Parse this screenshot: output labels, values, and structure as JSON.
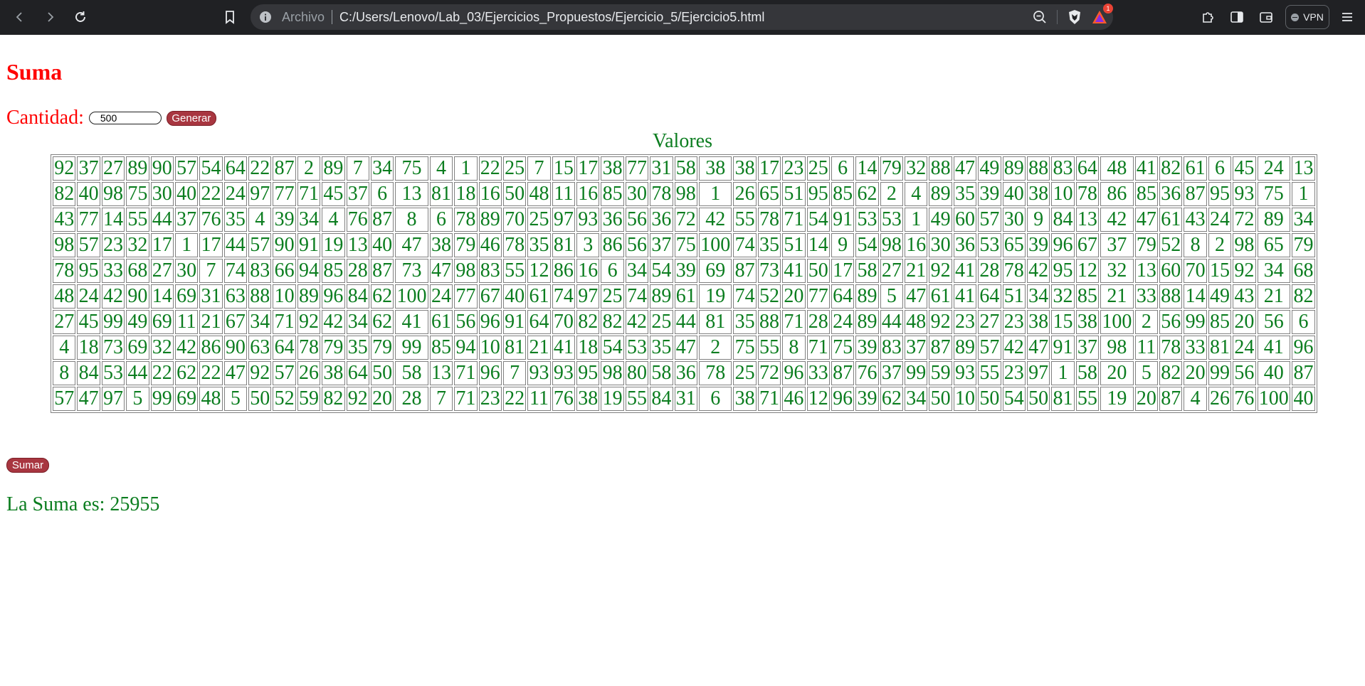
{
  "browser": {
    "url_scheme_label": "Archivo",
    "url": "C:/Users/Lenovo/Lab_03/Ejercicios_Propuestos/Ejercicio_5/Ejercicio5.html",
    "notification_count": "1",
    "vpn_label": "VPN",
    "icons": [
      "back-icon",
      "forward-icon",
      "reload-icon",
      "bookmark-icon",
      "info-icon",
      "zoom-out-icon",
      "brave-shield-icon",
      "brave-rewards-icon",
      "extensions-icon",
      "sidebar-icon",
      "wallet-icon",
      "menu-icon"
    ]
  },
  "page": {
    "title": "Suma",
    "quantity_label": "Cantidad:",
    "quantity_value": "500",
    "generate_label": "Generar",
    "table_caption": "Valores",
    "sum_label": "Sumar",
    "result_text": "La Suma es: 25955"
  },
  "colors": {
    "heading": "#ff0000",
    "values": "#0b7d1f",
    "button": "#a83640"
  },
  "table": {
    "rows": [
      [
        92,
        37,
        27,
        89,
        90,
        57,
        54,
        64,
        22,
        87,
        2,
        89,
        7,
        34,
        75,
        4,
        1,
        22,
        25,
        7,
        15,
        17,
        38,
        77,
        31,
        58,
        38,
        38,
        17,
        23,
        25,
        6,
        14,
        79,
        32,
        88,
        47,
        49,
        89,
        88,
        83,
        64,
        48,
        41,
        82,
        61,
        6,
        45,
        24,
        13
      ],
      [
        82,
        40,
        98,
        75,
        30,
        40,
        22,
        24,
        97,
        77,
        71,
        45,
        37,
        6,
        13,
        81,
        18,
        16,
        50,
        48,
        11,
        16,
        85,
        30,
        78,
        98,
        1,
        26,
        65,
        51,
        95,
        85,
        62,
        2,
        4,
        89,
        35,
        39,
        40,
        38,
        10,
        78,
        86,
        85,
        36,
        87,
        95,
        93,
        75,
        1
      ],
      [
        43,
        77,
        14,
        55,
        44,
        37,
        76,
        35,
        4,
        39,
        34,
        4,
        76,
        87,
        8,
        6,
        78,
        89,
        70,
        25,
        97,
        93,
        36,
        56,
        36,
        72,
        42,
        55,
        78,
        71,
        54,
        91,
        53,
        53,
        1,
        49,
        60,
        57,
        30,
        9,
        84,
        13,
        42,
        47,
        61,
        43,
        24,
        72,
        89,
        34
      ],
      [
        98,
        57,
        23,
        32,
        17,
        1,
        17,
        44,
        57,
        90,
        91,
        19,
        13,
        40,
        47,
        38,
        79,
        46,
        78,
        35,
        81,
        3,
        86,
        56,
        37,
        75,
        100,
        74,
        35,
        51,
        14,
        9,
        54,
        98,
        16,
        30,
        36,
        53,
        65,
        39,
        96,
        67,
        37,
        79,
        52,
        8,
        2,
        98,
        65,
        79
      ],
      [
        78,
        95,
        33,
        68,
        27,
        30,
        7,
        74,
        83,
        66,
        94,
        85,
        28,
        87,
        73,
        47,
        98,
        83,
        55,
        12,
        86,
        16,
        6,
        34,
        54,
        39,
        69,
        87,
        73,
        41,
        50,
        17,
        58,
        27,
        21,
        92,
        41,
        28,
        78,
        42,
        95,
        12,
        32,
        13,
        60,
        70,
        15,
        92,
        34,
        68
      ],
      [
        48,
        24,
        42,
        90,
        14,
        69,
        31,
        63,
        88,
        10,
        89,
        96,
        84,
        62,
        100,
        24,
        77,
        67,
        40,
        61,
        74,
        97,
        25,
        74,
        89,
        61,
        19,
        74,
        52,
        20,
        77,
        64,
        89,
        5,
        47,
        61,
        41,
        64,
        51,
        34,
        32,
        85,
        21,
        33,
        88,
        14,
        49,
        43,
        21,
        82
      ],
      [
        27,
        45,
        99,
        49,
        69,
        11,
        21,
        67,
        34,
        71,
        92,
        42,
        34,
        62,
        41,
        61,
        56,
        96,
        91,
        64,
        70,
        82,
        82,
        42,
        25,
        44,
        81,
        35,
        88,
        71,
        28,
        24,
        89,
        44,
        48,
        92,
        23,
        27,
        23,
        38,
        15,
        38,
        100,
        2,
        56,
        99,
        85,
        20,
        56,
        6
      ],
      [
        4,
        18,
        73,
        69,
        32,
        42,
        86,
        90,
        63,
        64,
        78,
        79,
        35,
        79,
        99,
        85,
        94,
        10,
        81,
        21,
        41,
        18,
        54,
        53,
        35,
        47,
        2,
        75,
        55,
        8,
        71,
        75,
        39,
        83,
        37,
        87,
        89,
        57,
        42,
        47,
        91,
        37,
        98,
        11,
        78,
        33,
        81,
        24,
        41,
        96
      ],
      [
        8,
        84,
        53,
        44,
        22,
        62,
        22,
        47,
        92,
        57,
        26,
        38,
        64,
        50,
        58,
        13,
        71,
        96,
        7,
        93,
        93,
        95,
        98,
        80,
        58,
        36,
        78,
        25,
        72,
        96,
        33,
        87,
        76,
        37,
        99,
        59,
        93,
        55,
        23,
        97,
        1,
        58,
        20,
        5,
        82,
        20,
        99,
        56,
        40,
        87
      ],
      [
        57,
        47,
        97,
        5,
        99,
        69,
        48,
        5,
        50,
        52,
        59,
        82,
        92,
        20,
        28,
        7,
        71,
        23,
        22,
        11,
        76,
        38,
        19,
        55,
        84,
        31,
        6,
        38,
        71,
        46,
        12,
        96,
        39,
        62,
        34,
        50,
        10,
        50,
        54,
        50,
        81,
        55,
        19,
        20,
        87,
        4,
        26,
        76,
        100,
        40
      ]
    ]
  }
}
